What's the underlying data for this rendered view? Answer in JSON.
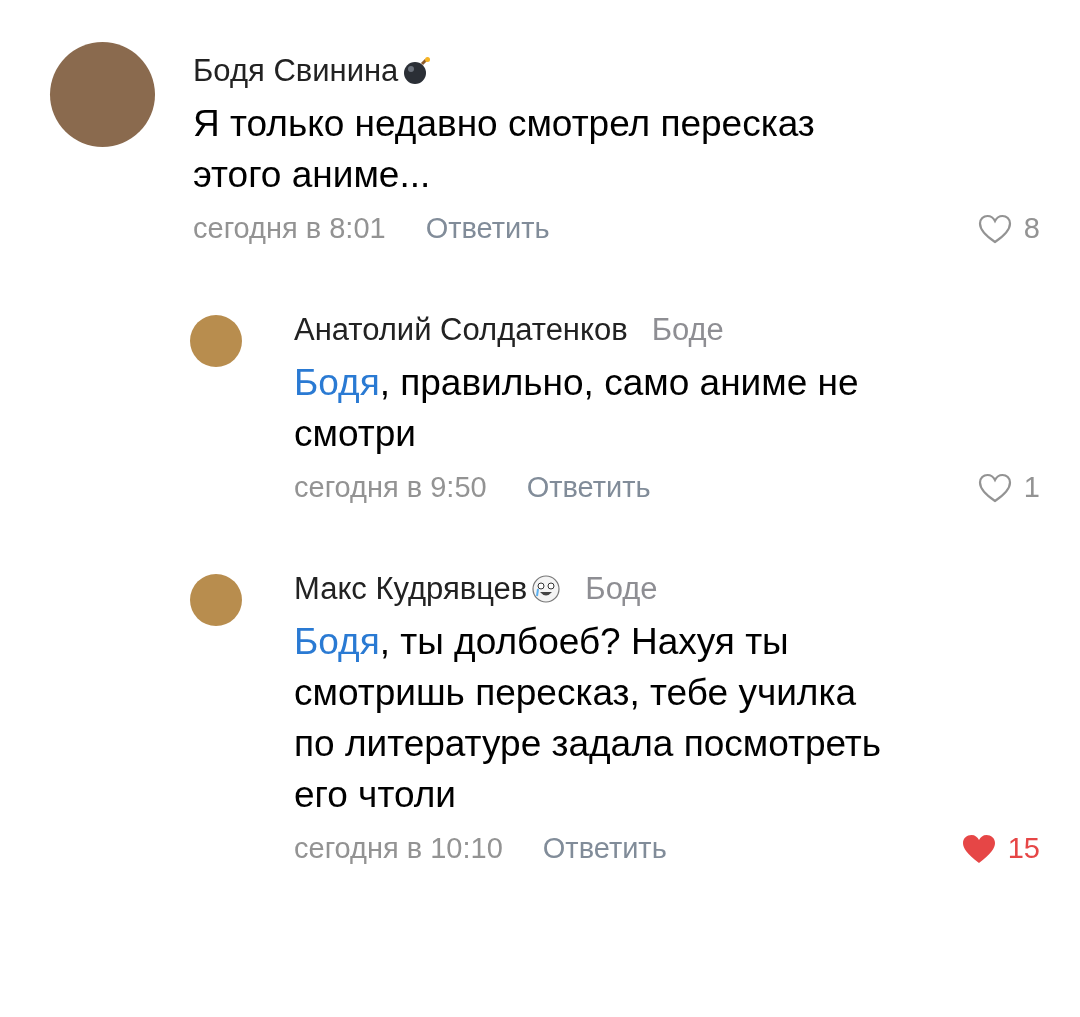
{
  "comments": [
    {
      "author": "Бодя Свинина",
      "badge": {
        "kind": "bomb"
      },
      "text": "Я только недавно смотрел пересказ\nэтого аниме...",
      "time": "сегодня в 8:01",
      "reply_label": "Ответить",
      "likes": "8",
      "liked": false,
      "replies": [
        {
          "author": "Анатолий Солдатенков",
          "reply_to": "Боде",
          "mention": "Бодя",
          "text": ", правильно, само аниме не\nсмотри",
          "time": "сегодня в 9:50",
          "reply_label": "Ответить",
          "likes": "1",
          "liked": false
        },
        {
          "author": "Макс Кудрявцев",
          "badge": {
            "kind": "smiley"
          },
          "reply_to": "Боде",
          "mention": "Бодя",
          "text": ", ты долбоеб? Нахуя ты\nсмотришь пересказ, тебе училка\nпо литературе задала посмотреть\nего чтоли",
          "time": "сегодня в 10:10",
          "reply_label": "Ответить",
          "likes": "15",
          "liked": true
        }
      ]
    }
  ]
}
